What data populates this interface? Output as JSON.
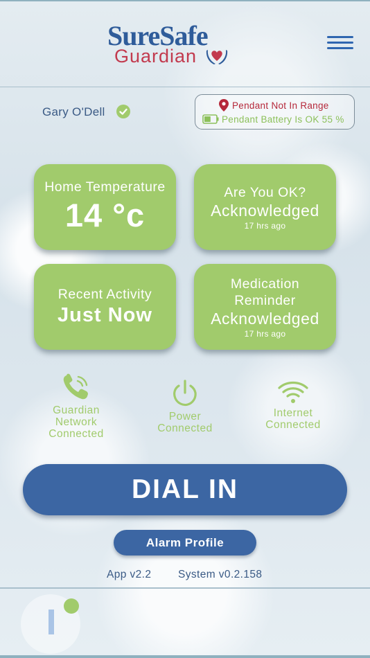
{
  "header": {
    "logo_top": "SureSafe",
    "logo_bottom": "Guardian",
    "menu_icon": "hamburger-menu-icon"
  },
  "user": {
    "name": "Gary O'Dell",
    "verified_icon": "check-circle-icon"
  },
  "pendant": {
    "range_status": "Pendant Not In Range",
    "battery_status": "Pendant Battery Is OK 55 %",
    "battery_percent": 55
  },
  "tiles": {
    "temperature": {
      "label": "Home Temperature",
      "value": "14 °c"
    },
    "are_you_ok": {
      "label": "Are You OK?",
      "status": "Acknowledged",
      "time": "17 hrs ago"
    },
    "activity": {
      "label": "Recent Activity",
      "value": "Just Now"
    },
    "medication": {
      "label_line1": "Medication",
      "label_line2": "Reminder",
      "status": "Acknowledged",
      "time": "17 hrs ago"
    }
  },
  "connections": {
    "network": {
      "line1": "Guardian",
      "line2": "Network",
      "line3": "Connected",
      "icon": "phone-icon"
    },
    "power": {
      "line1": "Power",
      "line2": "Connected",
      "icon": "power-icon"
    },
    "internet": {
      "line1": "Internet",
      "line2": "Connected",
      "icon": "wifi-icon"
    }
  },
  "actions": {
    "dial_in": "DIAL IN",
    "alarm_profile": "Alarm Profile"
  },
  "versions": {
    "app": "App v2.2",
    "system": "System v0.2.158"
  },
  "colors": {
    "brand_blue": "#3c66a3",
    "tile_green": "#a1cb6c",
    "alert_red": "#b5283a",
    "text_blue": "#3a5a85"
  }
}
